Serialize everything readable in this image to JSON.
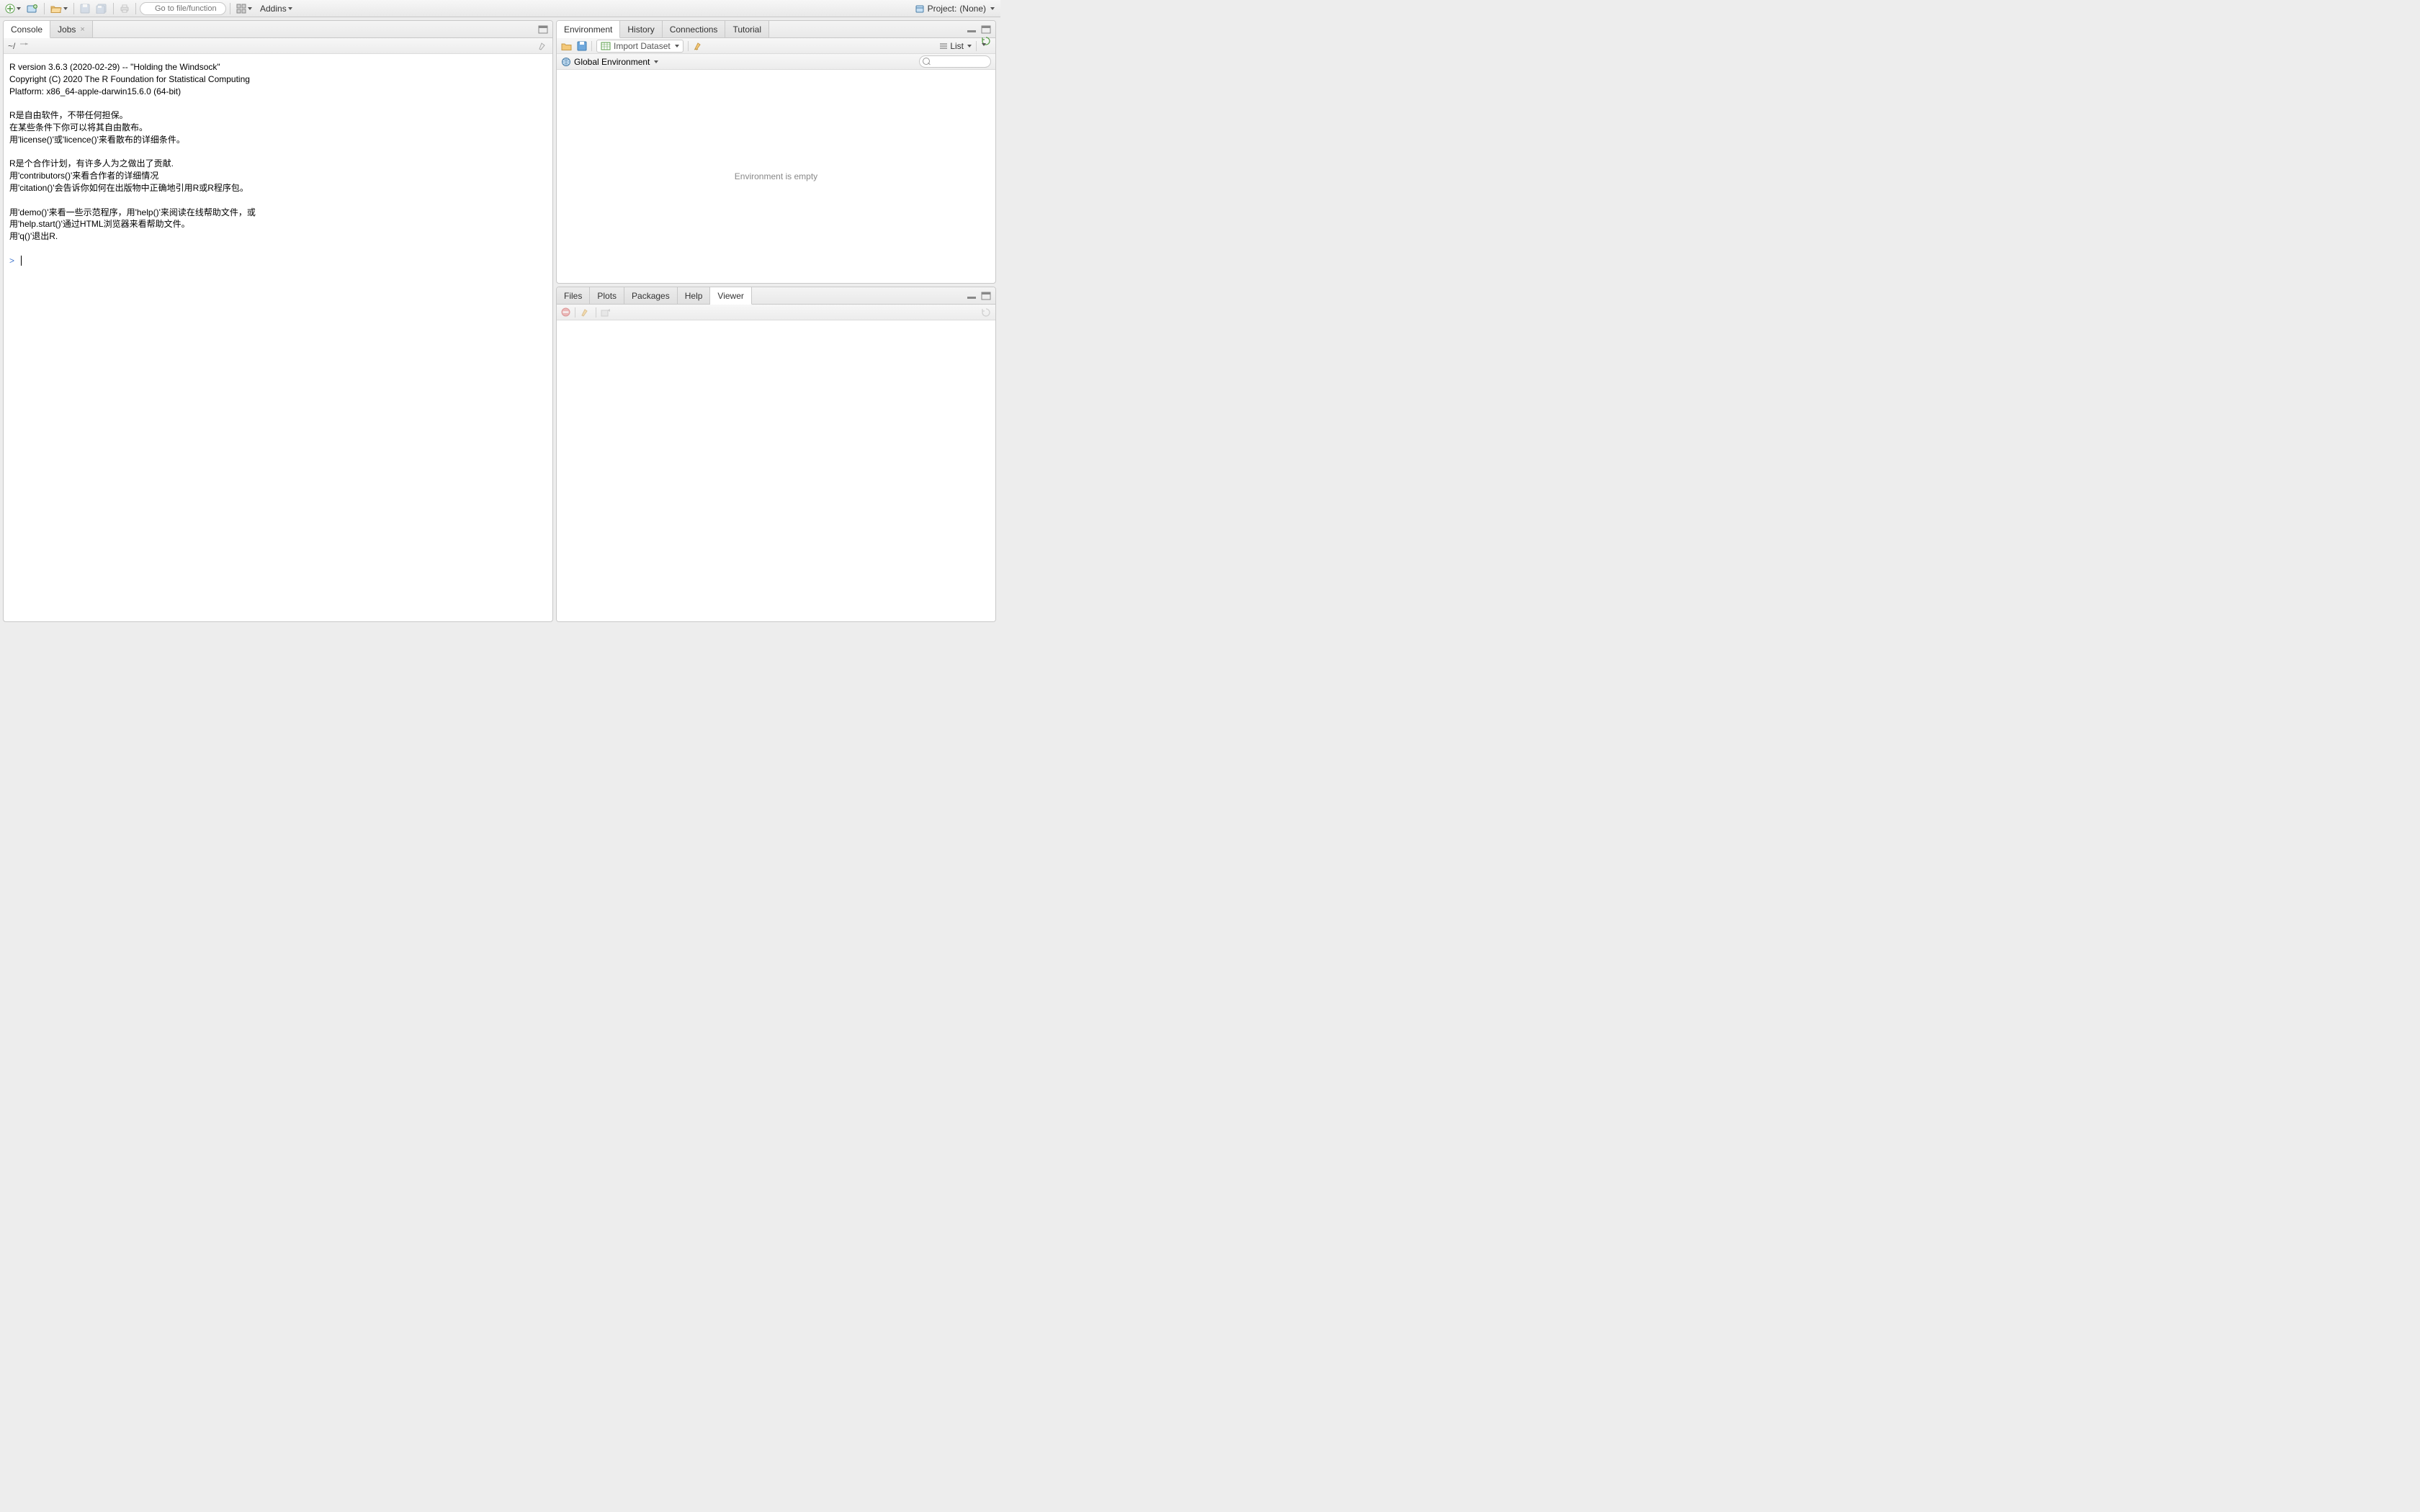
{
  "toolbar": {
    "goto_placeholder": "Go to file/function",
    "addins_label": "Addins"
  },
  "project": {
    "label": "Project:",
    "value": "(None)"
  },
  "left_pane": {
    "tabs": {
      "console": "Console",
      "jobs": "Jobs"
    },
    "console_path": "~/",
    "console_text": "R version 3.6.3 (2020-02-29) -- \"Holding the Windsock\"\nCopyright (C) 2020 The R Foundation for Statistical Computing\nPlatform: x86_64-apple-darwin15.6.0 (64-bit)\n\nR是自由软件，不带任何担保。\n在某些条件下你可以将其自由散布。\n用'license()'或'licence()'来看散布的详细条件。\n\nR是个合作计划，有许多人为之做出了贡献.\n用'contributors()'来看合作者的详细情况\n用'citation()'会告诉你如何在出版物中正确地引用R或R程序包。\n\n用'demo()'来看一些示范程序，用'help()'来阅读在线帮助文件，或\n用'help.start()'通过HTML浏览器来看帮助文件。\n用'q()'退出R.\n",
    "prompt": ">"
  },
  "env_pane": {
    "tabs": {
      "environment": "Environment",
      "history": "History",
      "connections": "Connections",
      "tutorial": "Tutorial"
    },
    "import_label": "Import Dataset",
    "view_mode": "List",
    "scope_label": "Global Environment",
    "empty_text": "Environment is empty"
  },
  "viewer_pane": {
    "tabs": {
      "files": "Files",
      "plots": "Plots",
      "packages": "Packages",
      "help": "Help",
      "viewer": "Viewer"
    }
  }
}
